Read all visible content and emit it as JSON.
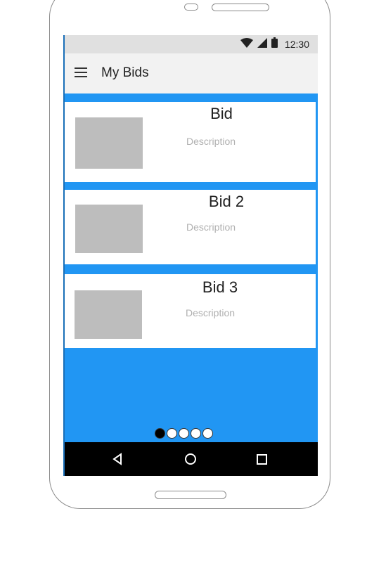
{
  "status_bar": {
    "time": "12:30",
    "icons": [
      "wifi-icon",
      "signal-icon",
      "battery-icon"
    ]
  },
  "app_bar": {
    "menu_icon": "menu-icon",
    "title": "My Bids"
  },
  "bids": [
    {
      "title": "Bid",
      "description": "Description"
    },
    {
      "title": "Bid 2",
      "description": "Description"
    },
    {
      "title": "Bid 3",
      "description": "Description"
    }
  ],
  "pager": {
    "total": 5,
    "active_index": 0
  },
  "nav_bar": {
    "buttons": [
      "back-icon",
      "home-icon",
      "recents-icon"
    ]
  },
  "colors": {
    "accent": "#2196f3",
    "status_bar": "#e0e0e0",
    "app_bar": "#f2f2f2",
    "thumbnail": "#bdbdbd",
    "description_text": "#b0b0b0",
    "nav_bar": "#000000"
  }
}
